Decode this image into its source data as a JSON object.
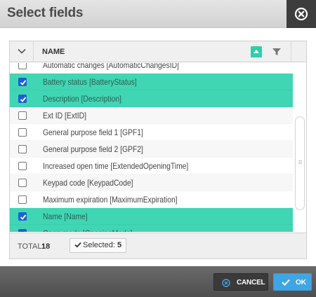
{
  "dialog": {
    "title": "Select fields"
  },
  "grid": {
    "column_header": "NAME",
    "rows": [
      {
        "label": "Automatic changes [AutomaticChangesID]",
        "checked": false
      },
      {
        "label": "Battery status [BatteryStatus]",
        "checked": true
      },
      {
        "label": "Description [Description]",
        "checked": true
      },
      {
        "label": "Ext ID [ExtID]",
        "checked": false
      },
      {
        "label": "General purpose field 1 [GPF1]",
        "checked": false
      },
      {
        "label": "General purpose field 2 [GPF2]",
        "checked": false
      },
      {
        "label": "Increased open time [ExtendedOpeningTime]",
        "checked": false
      },
      {
        "label": "Keypad code [KeypadCode]",
        "checked": false
      },
      {
        "label": "Maximum expiration [MaximumExpiration]",
        "checked": false
      },
      {
        "label": "Name [Name]",
        "checked": true
      },
      {
        "label": "Open mode [OpeningMode]",
        "checked": true
      }
    ]
  },
  "footer_info": {
    "total_label": "TOTAL:",
    "total_value": "18",
    "selected_label": "Selected:",
    "selected_value": "5"
  },
  "buttons": {
    "cancel_label": "CANCEL",
    "ok_label": "OK"
  },
  "colors": {
    "selected_row": "#40d6b3",
    "accent_teal": "#2bd0ad",
    "ok_button": "#3fa6e5",
    "checkbox_checked": "#1e5fd8"
  },
  "icons": {
    "close": "close-circle-icon",
    "select_all": "chevron-down-icon",
    "sort": "sort-ascending-icon",
    "filter": "filter-icon",
    "selected": "check-icon",
    "cancel": "cancel-circle-icon",
    "ok": "check-icon"
  }
}
